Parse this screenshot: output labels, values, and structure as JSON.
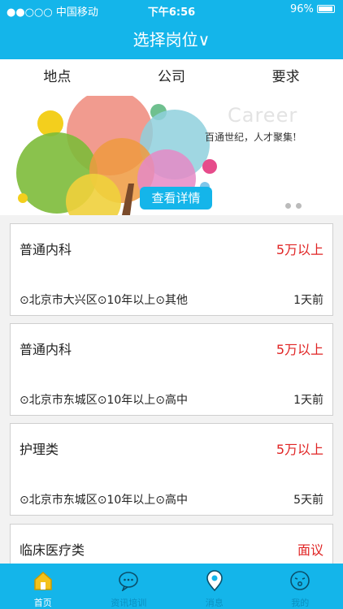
{
  "status": {
    "carrier": "●●○○○ 中国移动",
    "wifi_icon": "wifi-icon",
    "time": "下午6:56",
    "battery": "96%",
    "battery_level": 0.96
  },
  "nav": {
    "title": "选择岗位∨"
  },
  "filters": [
    "地点",
    "公司",
    "要求"
  ],
  "banner": {
    "brand": "Career",
    "slogan": "百通世纪，人才聚集!",
    "button": "查看详情",
    "page_dots": 2
  },
  "jobs": [
    {
      "title": "普通内科",
      "salary": "5万以上",
      "meta": "⊙北京市大兴区⊙10年以上⊙其他",
      "time": "1天前"
    },
    {
      "title": "普通内科",
      "salary": "5万以上",
      "meta": "⊙北京市东城区⊙10年以上⊙高中",
      "time": "1天前"
    },
    {
      "title": "护理类",
      "salary": "5万以上",
      "meta": "⊙北京市东城区⊙10年以上⊙高中",
      "time": "5天前"
    },
    {
      "title": "临床医疗类",
      "salary": "面议",
      "meta": "",
      "time": ""
    }
  ],
  "tabs": [
    {
      "label": "首页",
      "icon": "home-icon",
      "active": true
    },
    {
      "label": "资讯培训",
      "icon": "chat-icon",
      "active": false
    },
    {
      "label": "消息",
      "icon": "location-icon",
      "active": false
    },
    {
      "label": "我的",
      "icon": "face-icon",
      "active": false
    }
  ],
  "colors": {
    "primary": "#14b5ea",
    "salary": "#e02424",
    "active_tab_icon": "#f3c21a"
  }
}
